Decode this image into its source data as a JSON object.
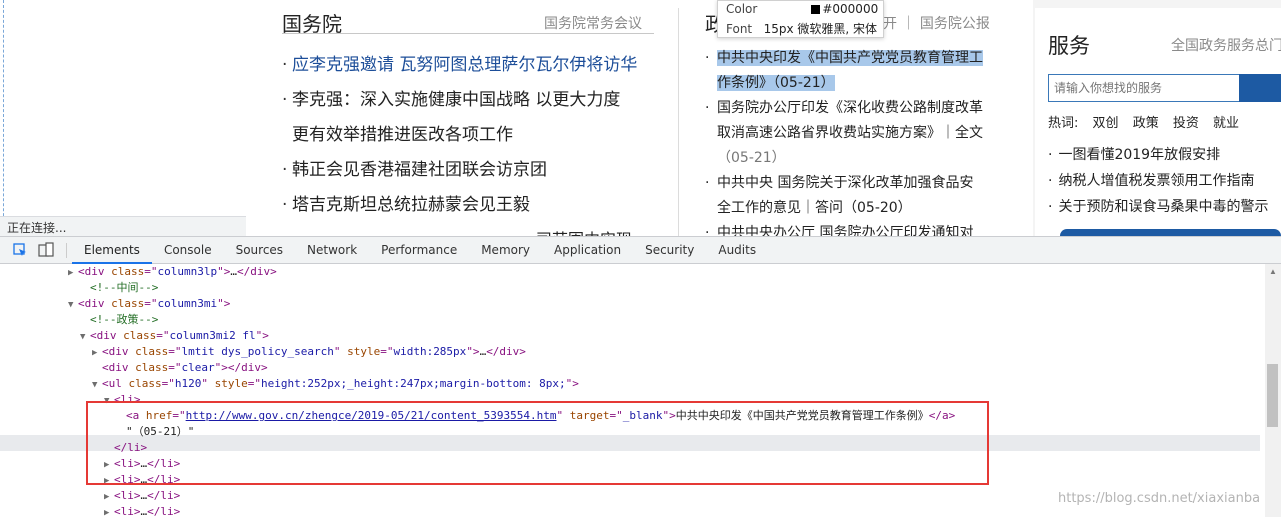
{
  "page": {
    "status": "正在连接...",
    "col1": {
      "title": "国务院",
      "more": "国务院常务会议",
      "items": [
        {
          "text": "应李克强邀请 瓦努阿图总理萨尔瓦尔伊将访华"
        },
        {
          "text": "李克强：深入实施健康中国战略 以更大力度"
        },
        {
          "text": "更有效举措推进医改各项工作"
        },
        {
          "text": "韩正会见香港福建社团联会访京团"
        },
        {
          "text": "塔吉克斯坦总统拉赫蒙会见王毅"
        }
      ],
      "fragment": "司范围内实现"
    },
    "col2": {
      "title": "政",
      "tabs": "开 ｜ 国务院公报",
      "items": [
        {
          "line1": "中共中央印发《中国共产党党员教育管理工",
          "line2": "作条例》（05-21）"
        },
        {
          "line1": "国务院办公厅印发《深化收费公路制度改革",
          "line2": "取消高速公路省界收费站实施方案》｜全文",
          "line3": "（05-21）"
        },
        {
          "line1": "中共中央 国务院关于深化改革加强食品安",
          "line2": "全工作的意见｜答问（05-20）"
        },
        {
          "line1": "中共中央办公厅 国务院办公厅印发通知对"
        }
      ]
    },
    "tooltip": {
      "color_label": "Color",
      "color_value": "#000000",
      "font_label": "Font",
      "font_value": "15px 微软雅黑, 宋体"
    },
    "service": {
      "title": "服务",
      "more": "全国政务服务总门",
      "search_placeholder": "请输入你想找的服务",
      "hot_label": "热词:",
      "hot_words": [
        "双创",
        "政策",
        "投资",
        "就业"
      ],
      "items": [
        "一图看懂2019年放假安排",
        "纳税人增值税发票领用工作指南",
        "关于预防和误食马桑果中毒的警示"
      ]
    }
  },
  "devtools": {
    "tabs": [
      "Elements",
      "Console",
      "Sources",
      "Network",
      "Performance",
      "Memory",
      "Application",
      "Security",
      "Audits"
    ],
    "lines": [
      {
        "indent": 0,
        "tri": "▶",
        "parts": [
          [
            "tag",
            "<div "
          ],
          [
            "an",
            "class"
          ],
          [
            "tag",
            "=\""
          ],
          [
            "av",
            "column3lp"
          ],
          [
            "tag",
            "\">"
          ],
          [
            "tx",
            "…"
          ],
          [
            "tag",
            "</div>"
          ]
        ]
      },
      {
        "indent": 1,
        "tri": "",
        "parts": [
          [
            "cm",
            "<!--中间-->"
          ]
        ]
      },
      {
        "indent": 0,
        "tri": "▼",
        "parts": [
          [
            "tag",
            "<div "
          ],
          [
            "an",
            "class"
          ],
          [
            "tag",
            "=\""
          ],
          [
            "av",
            "column3mi"
          ],
          [
            "tag",
            "\">"
          ]
        ]
      },
      {
        "indent": 1,
        "tri": "",
        "parts": [
          [
            "cm",
            "<!--政策-->"
          ]
        ]
      },
      {
        "indent": 1,
        "tri": "▼",
        "parts": [
          [
            "tag",
            "<div "
          ],
          [
            "an",
            "class"
          ],
          [
            "tag",
            "=\""
          ],
          [
            "av",
            "column3mi2 fl"
          ],
          [
            "tag",
            "\">"
          ]
        ]
      },
      {
        "indent": 2,
        "tri": "▶",
        "parts": [
          [
            "tag",
            "<div "
          ],
          [
            "an",
            "class"
          ],
          [
            "tag",
            "=\""
          ],
          [
            "av",
            "lmtit dys_policy_search"
          ],
          [
            "tag",
            "\" "
          ],
          [
            "an",
            "style"
          ],
          [
            "tag",
            "=\""
          ],
          [
            "av",
            "width:285px"
          ],
          [
            "tag",
            "\">"
          ],
          [
            "tx",
            "…"
          ],
          [
            "tag",
            "</div>"
          ]
        ]
      },
      {
        "indent": 2,
        "tri": "",
        "parts": [
          [
            "tag",
            "<div "
          ],
          [
            "an",
            "class"
          ],
          [
            "tag",
            "=\""
          ],
          [
            "av",
            "clear"
          ],
          [
            "tag",
            "\"></div>"
          ]
        ]
      },
      {
        "indent": 2,
        "tri": "▼",
        "parts": [
          [
            "tag",
            "<ul "
          ],
          [
            "an",
            "class"
          ],
          [
            "tag",
            "=\""
          ],
          [
            "av",
            "h120"
          ],
          [
            "tag",
            "\" "
          ],
          [
            "an",
            "style"
          ],
          [
            "tag",
            "=\""
          ],
          [
            "av",
            "height:252px;_height:247px;margin-bottom: 8px;"
          ],
          [
            "tag",
            "\">"
          ]
        ]
      },
      {
        "indent": 3,
        "tri": "▼",
        "parts": [
          [
            "tag",
            "<li>"
          ]
        ]
      },
      {
        "indent": 4,
        "tri": "",
        "parts": [
          [
            "tag",
            "<a "
          ],
          [
            "an",
            "href"
          ],
          [
            "tag",
            "=\""
          ],
          [
            "lnk",
            "http://www.gov.cn/zhengce/2019-05/21/content_5393554.htm"
          ],
          [
            "tag",
            "\" "
          ],
          [
            "an",
            "target"
          ],
          [
            "tag",
            "=\""
          ],
          [
            "av",
            "_blank"
          ],
          [
            "tag",
            "\">"
          ],
          [
            "tx",
            "中共中央印发《中国共产党党员教育管理工作条例》"
          ],
          [
            "tag",
            "</a>"
          ]
        ]
      },
      {
        "indent": 4,
        "tri": "",
        "parts": [
          [
            "tx",
            "\"（05-21）\""
          ]
        ]
      },
      {
        "indent": 3,
        "tri": "",
        "parts": [
          [
            "tag",
            "</li>"
          ]
        ]
      },
      {
        "indent": 3,
        "tri": "▶",
        "parts": [
          [
            "tag",
            "<li>"
          ],
          [
            "tx",
            "…"
          ],
          [
            "tag",
            "</li>"
          ]
        ]
      },
      {
        "indent": 3,
        "tri": "▶",
        "parts": [
          [
            "tag",
            "<li>"
          ],
          [
            "tx",
            "…"
          ],
          [
            "tag",
            "</li>"
          ]
        ]
      },
      {
        "indent": 3,
        "tri": "▶",
        "parts": [
          [
            "tag",
            "<li>"
          ],
          [
            "tx",
            "…"
          ],
          [
            "tag",
            "</li>"
          ]
        ]
      },
      {
        "indent": 3,
        "tri": "▶",
        "parts": [
          [
            "tag",
            "<li>"
          ],
          [
            "tx",
            "…"
          ],
          [
            "tag",
            "</li>"
          ]
        ]
      }
    ]
  },
  "watermark": "https://blog.csdn.net/xiaxianba"
}
